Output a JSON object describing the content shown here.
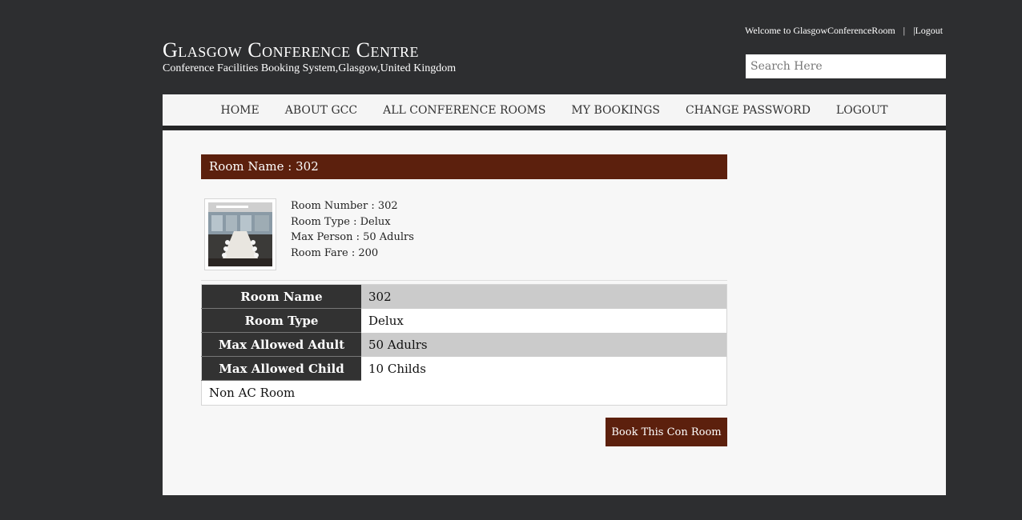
{
  "header": {
    "title": "Glasgow Conference Centre",
    "subtitle": "Conference Facilities Booking System,Glasgow,United Kingdom",
    "welcome": "Welcome to GlasgowConferenceRoom",
    "separator": "|",
    "logout_link": "|Logout",
    "search_placeholder": "Search Here"
  },
  "nav": {
    "items": [
      "HOME",
      "ABOUT GCC",
      "ALL CONFERENCE ROOMS",
      "MY BOOKINGS",
      "CHANGE PASSWORD",
      "LOGOUT"
    ]
  },
  "room": {
    "header": "Room Name : 302",
    "image_icon": "conference-room-photo",
    "info": {
      "number": "Room Number : 302",
      "type": "Room Type : Delux",
      "max_person": "Max Person : 50 Adulrs",
      "fare": "Room Fare : 200"
    },
    "table": [
      {
        "label": "Room Name",
        "value": "302"
      },
      {
        "label": "Room Type",
        "value": "Delux"
      },
      {
        "label": "Max Allowed Adult",
        "value": "50 Adulrs"
      },
      {
        "label": "Max Allowed Child",
        "value": "10 Childs"
      }
    ],
    "note": "Non AC Room",
    "book_label": "Book This Con Room"
  },
  "colors": {
    "background": "#2d2e30",
    "accent": "#5c200d",
    "table_header": "#323232"
  }
}
